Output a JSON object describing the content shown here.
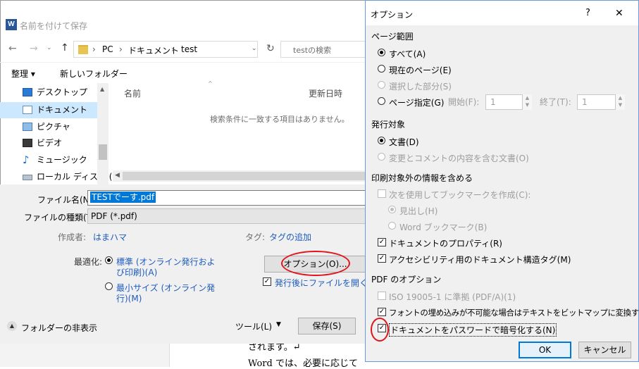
{
  "document": {
    "line1": "されます。↵",
    "line2": "Word では、必要に応じて"
  },
  "save_dialog": {
    "title": "名前を付けて保存",
    "breadcrumb": [
      "PC",
      "ドキュメント",
      "test"
    ],
    "search_placeholder": "testの検索",
    "toolbar": {
      "organize": "整理 ▾",
      "new_folder": "新しいフォルダー"
    },
    "nav_items": [
      "デスクトップ",
      "ドキュメント",
      "ピクチャ",
      "ビデオ",
      "ミュージック",
      "ローカル ディスク (C"
    ],
    "columns": {
      "name": "名前",
      "date": "更新日時"
    },
    "empty_message": "検索条件に一致する項目はありません。",
    "filename_label": "ファイル名(N):",
    "filename_value": "TESTでーす.pdf",
    "filetype_label": "ファイルの種類(T):",
    "filetype_value": "PDF (*.pdf)",
    "author_label": "作成者:",
    "author_value": "はまハマ",
    "tag_label": "タグ:",
    "tag_value": "タグの追加",
    "optimize_label": "最適化:",
    "optimize_standard": [
      "標準 (オンライン発行およ",
      "び印刷)(A)"
    ],
    "optimize_min": [
      "最小サイズ (オンライン発",
      "行)(M)"
    ],
    "options_button": "オプション(O)...",
    "open_after": "発行後にファイルを開く(E)",
    "hide_folders": "フォルダーの非表示",
    "tools": "ツール(L)",
    "save": "保存(S)"
  },
  "options_dialog": {
    "title": "オプション",
    "help": "?",
    "close": "✕",
    "page_range_header": "ページ範囲",
    "all": "すべて(A)",
    "current_page": "現在のページ(E)",
    "selection": "選択した部分(S)",
    "pages": "ページ指定(G)",
    "from_label": "開始(F):",
    "from_value": "1",
    "to_label": "終了(T):",
    "to_value": "1",
    "publish_header": "発行対象",
    "document": "文書(D)",
    "doc_with_markup": "変更とコメントの内容を含む文書(O)",
    "nonprint_header": "印刷対象外の情報を含める",
    "create_bookmarks": "次を使用してブックマークを作成(C):",
    "headings": "見出し(H)",
    "word_bookmarks": "Word ブックマーク(B)",
    "doc_properties": "ドキュメントのプロパティ(R)",
    "accessibility_tags": "アクセシビリティ用のドキュメント構造タグ(M)",
    "pdf_options_header": "PDF のオプション",
    "iso": "ISO 19005-1 に準拠 (PDF/A)(1)",
    "bitmap_text": "フォントの埋め込みが不可能な場合はテキストをビットマップに変換する(X)",
    "encrypt": "ドキュメントをパスワードで暗号化する(N)",
    "ok": "OK",
    "cancel": "キャンセル"
  }
}
